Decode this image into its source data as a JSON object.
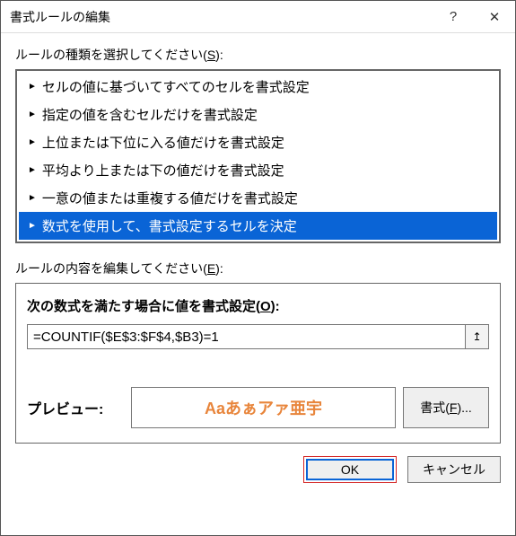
{
  "titlebar": {
    "title": "書式ルールの編集",
    "help": "?",
    "close": "✕"
  },
  "section_rule_type": {
    "label_prefix": "ルールの種類を選択してください(",
    "label_key": "S",
    "label_suffix": "):",
    "items": [
      "セルの値に基づいてすべてのセルを書式設定",
      "指定の値を含むセルだけを書式設定",
      "上位または下位に入る値だけを書式設定",
      "平均より上または下の値だけを書式設定",
      "一意の値または重複する値だけを書式設定",
      "数式を使用して、書式設定するセルを決定"
    ],
    "selected_index": 5
  },
  "section_content": {
    "label_prefix": "ルールの内容を編集してください(",
    "label_key": "E",
    "label_suffix": "):",
    "formula_label_prefix": "次の数式を満たす場合に値を書式設定(",
    "formula_label_key": "O",
    "formula_label_suffix": "):",
    "formula_value": "=COUNTIF($E$3:$F$4,$B3)=1",
    "ref_icon": "↥",
    "preview_label": "プレビュー:",
    "preview_sample": "Aaあぁアァ亜宇",
    "format_button_prefix": "書式(",
    "format_button_key": "F",
    "format_button_suffix": ")..."
  },
  "buttons": {
    "ok": "OK",
    "cancel": "キャンセル"
  }
}
